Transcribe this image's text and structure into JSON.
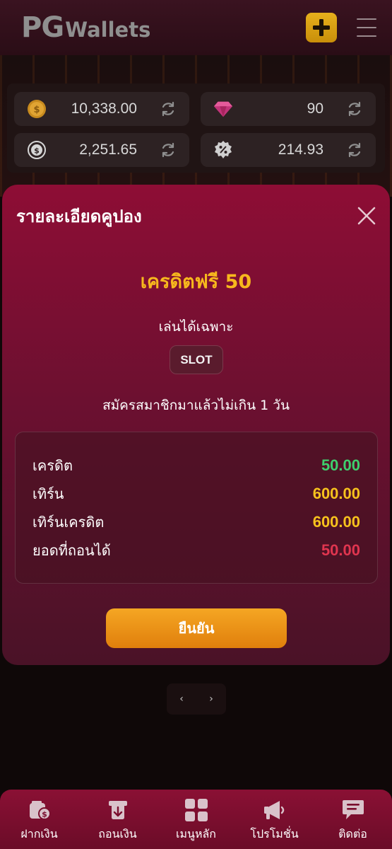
{
  "header": {
    "logo_pg": "PG",
    "logo_wallets": "Wallets",
    "add_icon": "plus-icon",
    "menu_icon": "hamburger-menu-icon"
  },
  "balances": [
    {
      "icon": "coin-icon",
      "value": "10,338.00"
    },
    {
      "icon": "diamond-icon",
      "value": "90"
    },
    {
      "icon": "cashback-icon",
      "value": "2,251.65"
    },
    {
      "icon": "percent-badge-icon",
      "value": "214.93"
    }
  ],
  "modal": {
    "title": "รายละเอียดคูปอง",
    "coupon_name": "เครดิตฟรี 50",
    "playable_label": "เล่นได้เฉพาะ",
    "game_tag": "SLOT",
    "condition": "สมัครสมาชิกมาแล้วไม่เกิน 1 วัน",
    "details": [
      {
        "label": "เครดิต",
        "value": "50.00",
        "color": "#3ecf6d"
      },
      {
        "label": "เทิร์น",
        "value": "600.00",
        "color": "#f7c21d"
      },
      {
        "label": "เทิร์นเครดิต",
        "value": "600.00",
        "color": "#f7c21d"
      },
      {
        "label": "ยอดที่ถอนได้",
        "value": "50.00",
        "color": "#e0354f"
      }
    ],
    "confirm_label": "ยืนยัน"
  },
  "pager": {
    "prev": "‹",
    "next": "›"
  },
  "bottom_nav": [
    {
      "label": "ฝากเงิน",
      "icon": "deposit-icon"
    },
    {
      "label": "ถอนเงิน",
      "icon": "withdraw-icon"
    },
    {
      "label": "เมนูหลัก",
      "icon": "grid-menu-icon"
    },
    {
      "label": "โปรโมชั่น",
      "icon": "megaphone-icon"
    },
    {
      "label": "ติดต่อ",
      "icon": "chat-icon"
    }
  ],
  "colors": {
    "accent_gold": "#f7b81d",
    "modal_top": "#8e0d35",
    "confirm_orange": "#f5a623"
  }
}
